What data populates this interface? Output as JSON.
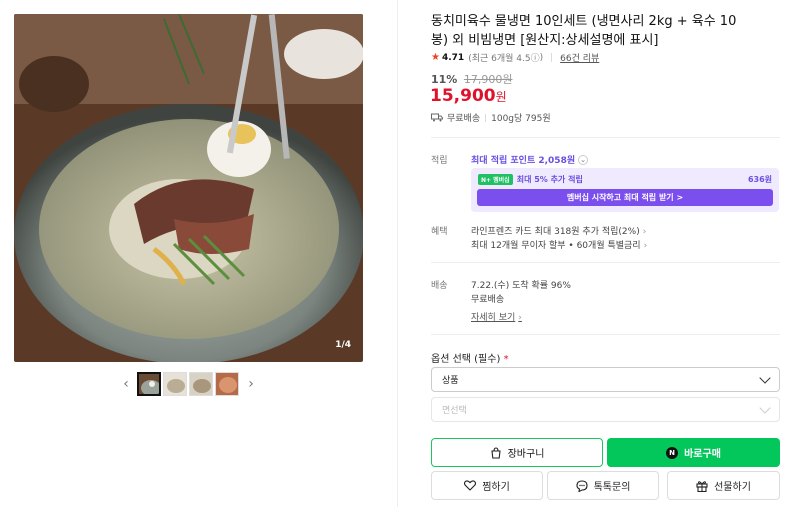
{
  "gallery": {
    "counter": "1/4",
    "prev_icon": "chevron-left-icon",
    "next_icon": "chevron-right-icon",
    "thumbnail_count": 4,
    "active_thumbnail": 1
  },
  "product": {
    "title": "동치미육수 물냉면 10인세트 (냉면사리 2kg + 육수 10봉) 외 비빔냉면 [원산지:상세설명에 표시]",
    "rating": {
      "star_icon": "star-icon",
      "score": "4.71",
      "period_text": "(최근 6개월 4.5",
      "info_icon": "ⓘ",
      "period_close": ")",
      "reviews": "66건 리뷰"
    },
    "discount_percent": "11%",
    "original_price": "17,900원",
    "sale_price": "15,900",
    "sale_unit": "원",
    "shipping": {
      "icon": "truck-icon",
      "text": "무료배송",
      "unit_price": "100g당 795원"
    }
  },
  "points": {
    "label": "적립",
    "max_text": "최대 적립 포인트 2,058원",
    "plus_badge": "N+ 멤버십",
    "plus_text": "최대 5% 추가 적립",
    "plus_amount": "636원",
    "plus_button": "멤버십 시작하고 최대 적립 받기 >"
  },
  "benefits": {
    "label": "혜택",
    "line1": "라인프렌즈 카드 최대 318원 추가 적립(2%)",
    "line2": "최대 12개월 무이자 할부 • 60개월 특별금리"
  },
  "delivery": {
    "label": "배송",
    "arrival": "7.22.(수) 도착 확률 96%",
    "fee": "무료배송",
    "details_link": "자세히 보기"
  },
  "options": {
    "label": "옵션 선택 (필수)",
    "required_mark": "*",
    "select1": "상품",
    "select2_placeholder": "면선택"
  },
  "actions": {
    "cart": "장바구니",
    "buy": "바로구매",
    "buy_badge": "N",
    "wishlist": "찜하기",
    "talk": "톡톡문의",
    "gift": "선물하기"
  },
  "colors": {
    "price_red": "#e0112b",
    "naver_green": "#03c75a",
    "membership_purple": "#7b4fee"
  }
}
